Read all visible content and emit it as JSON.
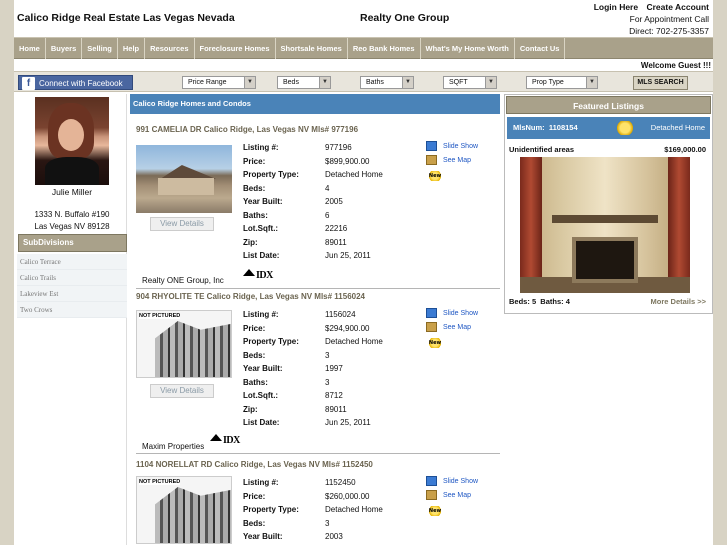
{
  "header": {
    "title": "Calico Ridge Real Estate Las Vegas Nevada",
    "brand": "Realty One Group",
    "login": "Login Here",
    "create_account": "Create Account",
    "appointment": "For Appointment Call",
    "phone": "Direct: 702-275-3357"
  },
  "nav": [
    "Home",
    "Buyers",
    "Selling",
    "Help",
    "Resources",
    "Foreclosure Homes",
    "Shortsale Homes",
    "Reo Bank Homes",
    "What's My Home Worth",
    "Contact Us"
  ],
  "welcome": "Welcome  Guest !!!",
  "search": {
    "facebook": "Connect with Facebook",
    "price_range": "Price Range",
    "beds": "Beds",
    "baths": "Baths",
    "sqft": "SQFT",
    "prop_type": "Prop Type",
    "button": "MLS SEARCH"
  },
  "sidebar": {
    "agent_name": "Julie Miller",
    "address_line1": "1333 N. Buffalo #190",
    "address_line2": "Las Vegas NV 89128",
    "subdivisions_title": "SubDivisions",
    "subdivisions": [
      "Calico Terrace",
      "Calico Trails",
      "Lakeview Est",
      "Two Crows"
    ]
  },
  "main": {
    "heading": "Calico Ridge Homes and Condos",
    "view_details": "View Details",
    "slide_show": "Slide Show",
    "see_map": "See Map",
    "new_badge": "New",
    "not_pictured": "NOT PICTURED",
    "labels": [
      "Listing #:",
      "Price:",
      "Property Type:",
      "Beds:",
      "Year Built:",
      "Baths:",
      "Lot.Sqft.:",
      "Zip:",
      "List Date:"
    ],
    "idx_label": "IDX",
    "listings": [
      {
        "title": "991 CAMELIA DR Calico Ridge, Las Vegas NV Mls# 977196",
        "values": [
          "977196",
          "$899,900.00",
          "Detached Home",
          "4",
          "2005",
          "6",
          "22216",
          "89011",
          "Jun 25, 2011"
        ],
        "broker": "Realty ONE Group, Inc"
      },
      {
        "title": "904 RHYOLITE TE Calico Ridge, Las Vegas NV Mls# 1156024",
        "values": [
          "1156024",
          "$294,900.00",
          "Detached Home",
          "3",
          "1997",
          "3",
          "8712",
          "89011",
          "Jun 25, 2011"
        ],
        "broker": "Maxim Properties"
      },
      {
        "title": "1104 NORELLAT RD Calico Ridge, Las Vegas NV Mls# 1152450",
        "values": [
          "1152450",
          "$260,000.00",
          "Detached Home",
          "3",
          "2003"
        ],
        "broker": ""
      }
    ]
  },
  "featured": {
    "title": "Featured Listings",
    "mls_label": "MlsNum:",
    "mls_num": "1108154",
    "type": "Detached Home",
    "area": "Unidentified areas",
    "price": "$169,000.00",
    "beds_label": "Beds:",
    "beds": "5",
    "baths_label": "Baths:",
    "baths": "4",
    "more": "More Details >>"
  }
}
